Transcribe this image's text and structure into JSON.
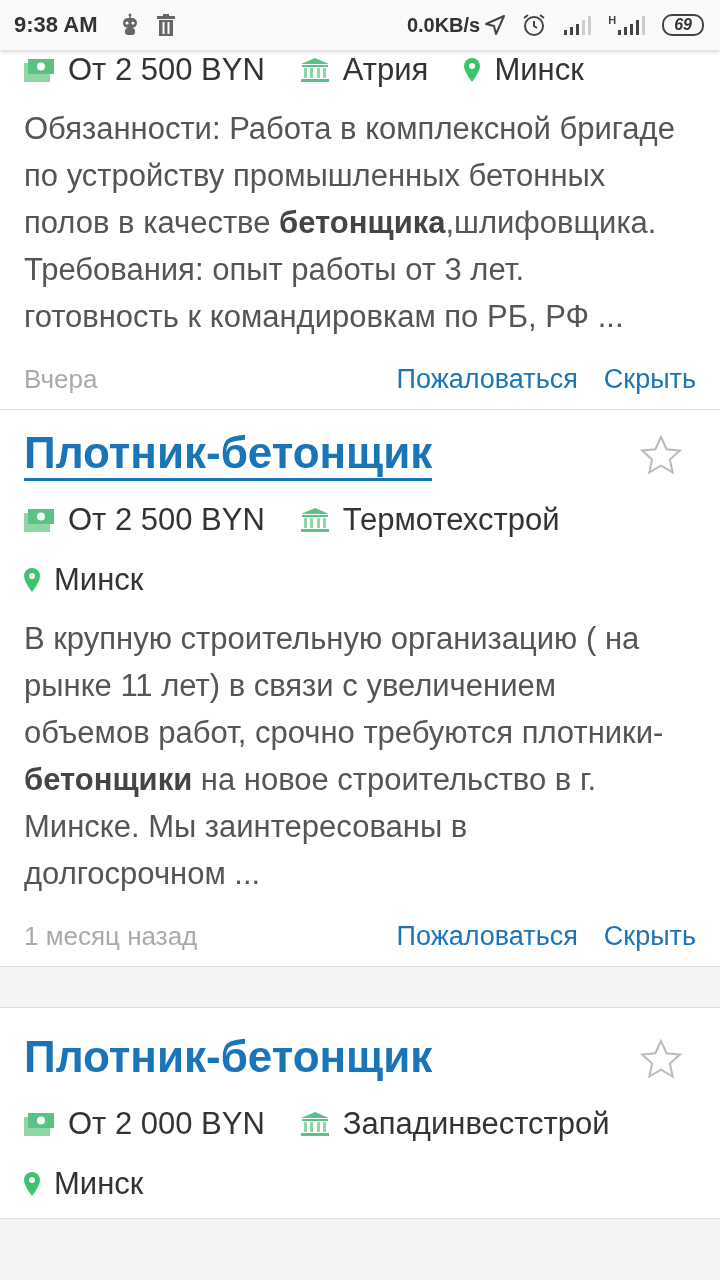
{
  "status_bar": {
    "time": "9:38 AM",
    "speed": "0.0KB/s",
    "network_label": "H",
    "battery": "69"
  },
  "vacancies": [
    {
      "salary": "От 2 500 BYN",
      "company": "Атрия",
      "city": "Минск",
      "city_on_own_line": false,
      "description": "Обязанности: Работа в комплексной бригаде по устройству промышленных бетонных полов в качестве **бетонщика**,шлифовщика. Требования: опыт работы от 3 лет. готовность к командировкам по РБ, РФ ...",
      "date": "Вчера",
      "report": "Пожаловаться",
      "hide": "Скрыть"
    },
    {
      "title": "Плотник-бетонщик",
      "underlined": true,
      "starred": false,
      "salary": "От 2 500 BYN",
      "company": "Термотехстрой",
      "city": "Минск",
      "city_on_own_line": true,
      "description": "В крупную строительную организацию ( на рынке 11 лет) в связи с увеличением объемов работ, срочно требуются плотники-**бетонщики** на новое строительство в г. Минске. Мы заинтересованы в долгосрочном ...",
      "date": "1 месяц назад",
      "report": "Пожаловаться",
      "hide": "Скрыть"
    },
    {
      "title": "Плотник-бетонщик",
      "underlined": false,
      "starred": false,
      "salary": "От 2 000 BYN",
      "company": "Западинвестстрой",
      "city": "Минск",
      "city_on_own_line": true
    }
  ]
}
